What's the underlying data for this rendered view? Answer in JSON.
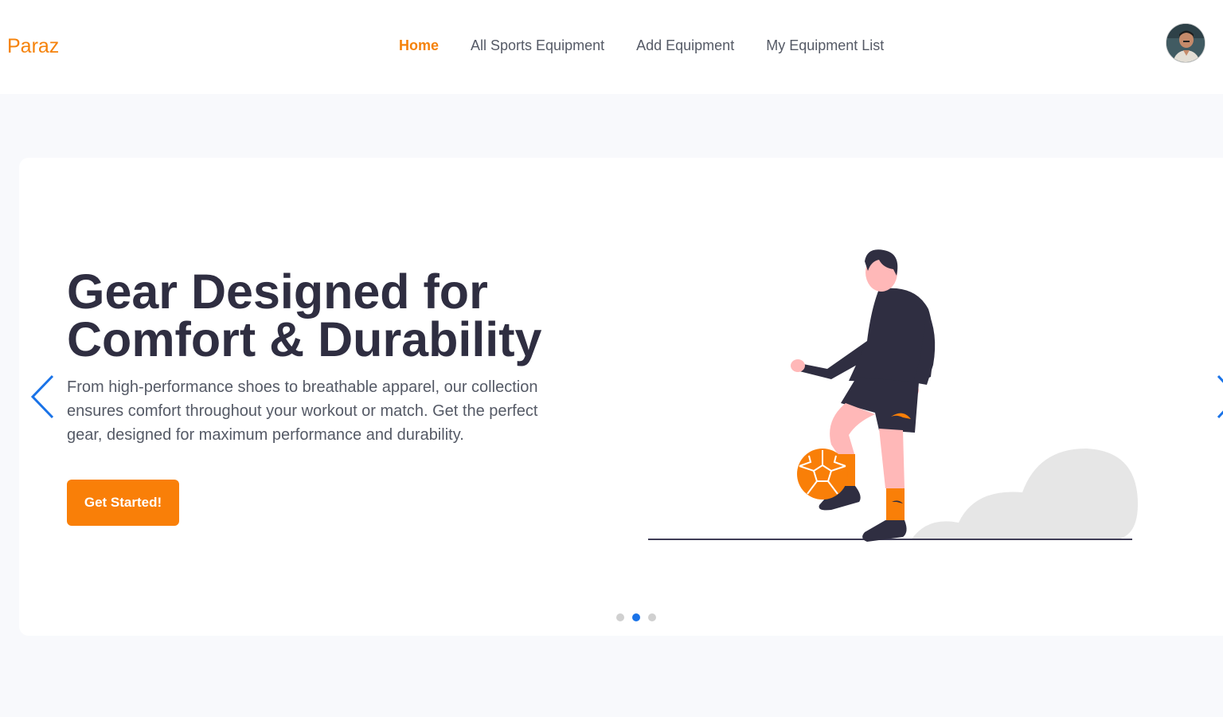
{
  "header": {
    "logo": "Paraz",
    "nav": [
      {
        "label": "Home",
        "active": true
      },
      {
        "label": "All Sports Equipment",
        "active": false
      },
      {
        "label": "Add Equipment",
        "active": false
      },
      {
        "label": "My Equipment List",
        "active": false
      }
    ],
    "avatar_icon": "user-avatar-photo"
  },
  "hero": {
    "title_line1": "Gear Designed for",
    "title_line2": "Comfort & Durability",
    "description": "From high-performance shoes to breathable apparel, our collection ensures comfort throughout your workout or match. Get the perfect gear, designed for maximum performance and durability.",
    "cta_label": "Get Started!",
    "illustration_icon": "soccer-player-illustration"
  },
  "carousel": {
    "slide_count": 3,
    "active_index": 1,
    "prev_icon": "chevron-left-icon",
    "next_icon": "chevron-right-icon"
  },
  "colors": {
    "accent": "#f97f08",
    "brand": "#f5820a",
    "heading": "#2f2e41",
    "text": "#555a66",
    "arrow": "#1a73e8",
    "page_bg": "#f8f9fc",
    "card_bg": "#ffffff"
  }
}
